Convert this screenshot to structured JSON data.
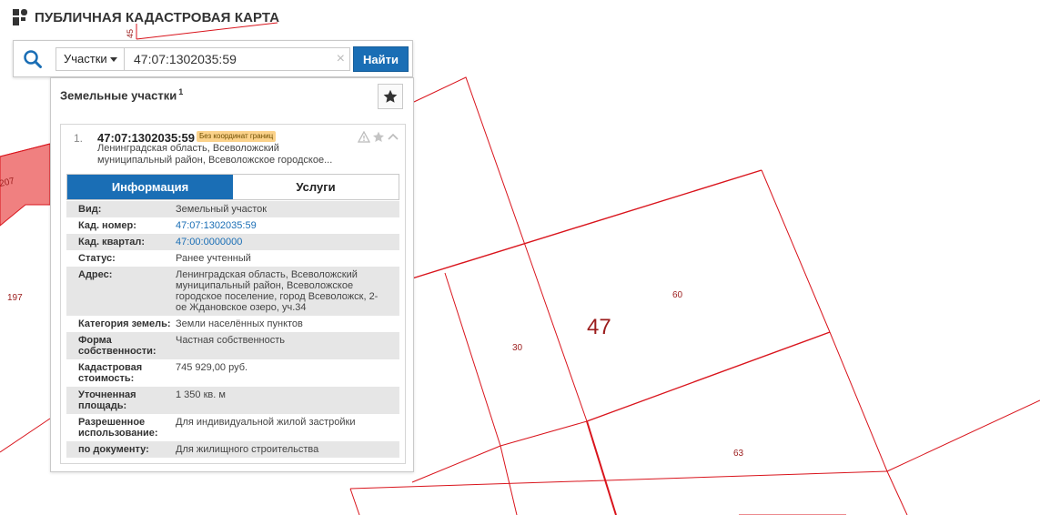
{
  "header": {
    "title": "ПУБЛИЧНАЯ КАДАСТРОВАЯ КАРТА"
  },
  "search": {
    "type_label": "Участки",
    "value": "47:07:1302035:59",
    "find_label": "Найти",
    "clear_glyph": "×"
  },
  "panel": {
    "title": "Земельные участки",
    "count": "1",
    "result": {
      "index": "1.",
      "cad_number": "47:07:1302035:59",
      "badge": "Без координат границ",
      "address_short": "Ленинградская область, Всеволожский муниципальный район, Всеволожское городское...",
      "tabs": {
        "info": "Информация",
        "services": "Услуги"
      },
      "fields": [
        {
          "key": "Вид:",
          "value": "Земельный участок",
          "link": false
        },
        {
          "key": "Кад. номер:",
          "value": "47:07:1302035:59",
          "link": true
        },
        {
          "key": "Кад. квартал:",
          "value": "47:00:0000000",
          "link": true
        },
        {
          "key": "Статус:",
          "value": "Ранее учтенный",
          "link": false
        },
        {
          "key": "Адрес:",
          "value": "Ленинградская область, Всеволожский муниципальный район, Всеволожское городское поселение, город Всеволожск, 2-ое Ждановское озеро, уч.34",
          "link": false
        },
        {
          "key": "Категория земель:",
          "value": "Земли населённых пунктов",
          "link": false
        },
        {
          "key": "Форма собственности:",
          "value": "Частная собственность",
          "link": false
        },
        {
          "key": "Кадастровая стоимость:",
          "value": "745 929,00 руб.",
          "link": false
        },
        {
          "key": "Уточненная площадь:",
          "value": "1 350 кв. м",
          "link": false
        },
        {
          "key": "Разрешенное использование:",
          "value": "Для индивидуальной жилой застройки",
          "link": false
        },
        {
          "key": "по документу:",
          "value": "Для жилищного строительства",
          "link": false
        }
      ]
    }
  },
  "map": {
    "labels": {
      "block_47": "47",
      "parcel_60": "60",
      "parcel_30": "30",
      "parcel_63": "63",
      "parcel_197": "197",
      "parcel_207": "207",
      "parcel_45": "45"
    },
    "line_color": "#d9141c",
    "parcel_fill": "#f08080"
  },
  "colors": {
    "accent": "#1a6eb5",
    "badge": "#fbd28a"
  },
  "icons": [
    "logo-icon",
    "search-icon",
    "caret-down-icon",
    "clear-icon",
    "star-icon",
    "warning-icon",
    "chevron-up-icon"
  ]
}
